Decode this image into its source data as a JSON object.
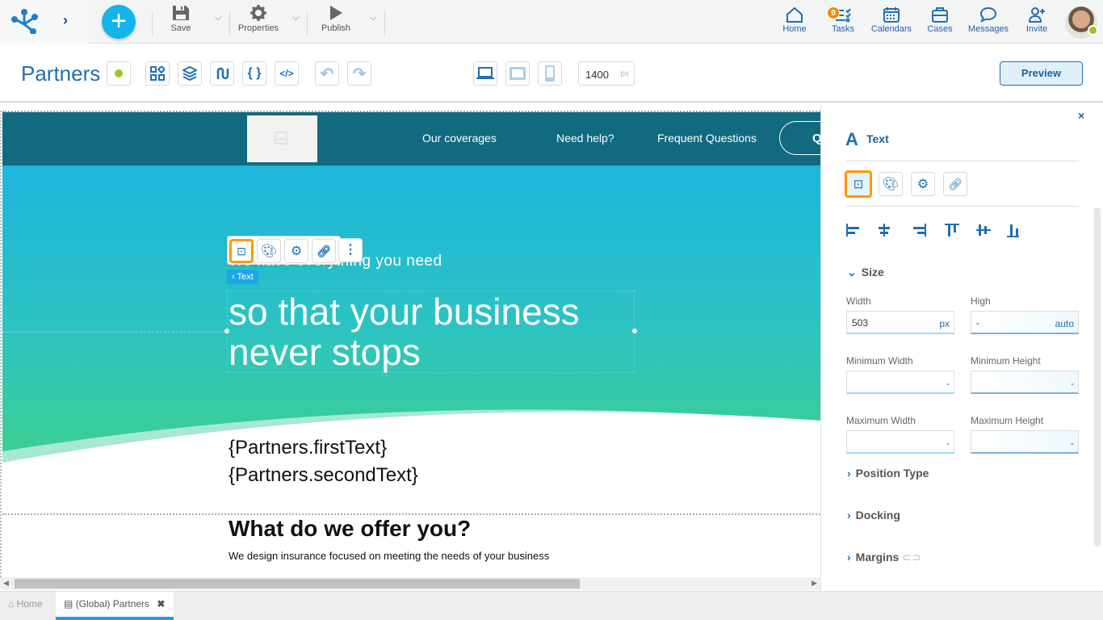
{
  "topbar": {
    "save": "Save",
    "properties": "Properties",
    "publish": "Publish",
    "nav": [
      {
        "label": "Home",
        "icon": "home-icon"
      },
      {
        "label": "Tasks",
        "icon": "tasks-icon",
        "badge": "9"
      },
      {
        "label": "Calendars",
        "icon": "calendar-icon"
      },
      {
        "label": "Cases",
        "icon": "briefcase-icon"
      },
      {
        "label": "Messages",
        "icon": "chat-icon"
      },
      {
        "label": "Invite",
        "icon": "add-user-icon"
      }
    ]
  },
  "toolbar": {
    "title": "Partners",
    "width_value": "1400",
    "width_unit": "px",
    "preview": "Preview"
  },
  "site": {
    "nav": [
      "Our coverages",
      "Need help?",
      "Frequent Questions"
    ],
    "nav_button": "Q",
    "subtitle": "We have everything you need",
    "headline1": "so that your business",
    "headline2": "never stops",
    "first_text": "{Partners.firstText}",
    "second_text": "{Partners.secondText}",
    "offer_title": "What do we offer you?",
    "offer_text": "We design insurance focused on meeting the needs of your business",
    "element_tag": "Text"
  },
  "panel": {
    "title": "Text",
    "size_section": "Size",
    "width_label": "Width",
    "width_value": "503",
    "width_unit": "px",
    "high_label": "High",
    "high_value": "-",
    "high_unit": "auto",
    "min_width_label": "Minimum Width",
    "min_width_value": "-",
    "min_height_label": "Minimum Height",
    "min_height_value": "-",
    "max_width_label": "Maximum Width",
    "max_width_value": "-",
    "max_height_label": "Maximum Height",
    "max_height_value": "-",
    "position_type": "Position Type",
    "docking": "Docking",
    "margins": "Margins"
  },
  "tabs": [
    {
      "label": "Home"
    },
    {
      "label": "(Global) Partners",
      "active": true
    }
  ],
  "colors": {
    "accent": "#1f6fb5",
    "selection": "#ff9800",
    "nav_bg": "#116a7f",
    "hero_top": "#1db5dc",
    "hero_bottom": "#3dcf93",
    "status": "#9bc232"
  }
}
